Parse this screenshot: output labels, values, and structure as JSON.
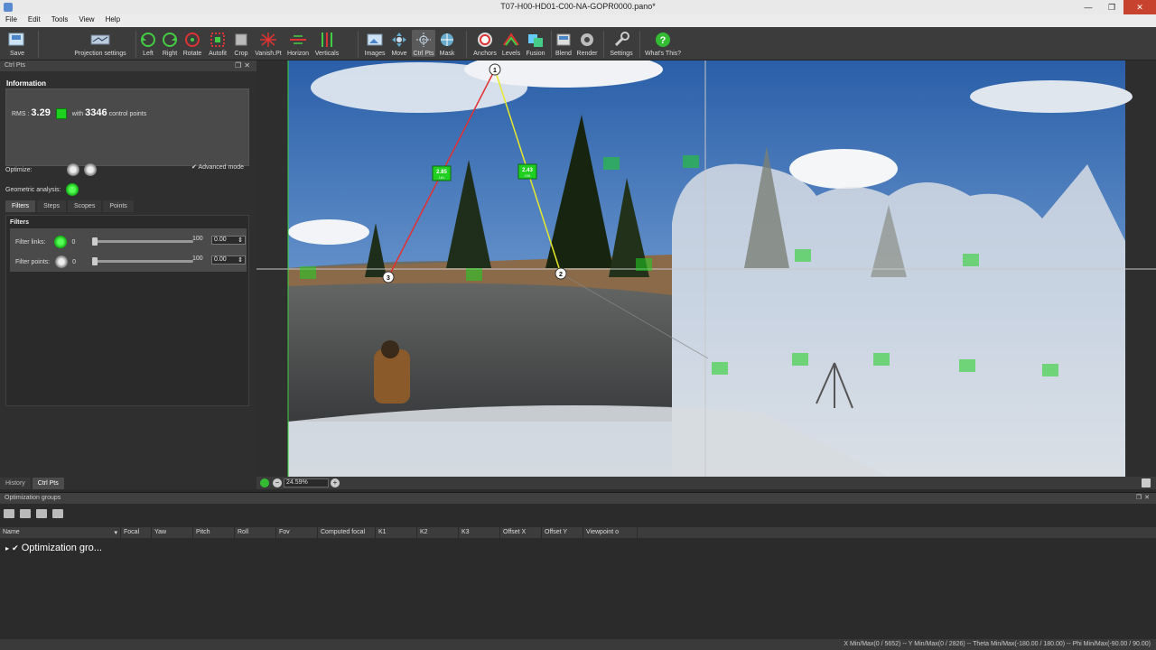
{
  "window": {
    "title": "T07-H00-HD01-C00-NA-GOPR0000.pano*"
  },
  "menu": [
    "File",
    "Edit",
    "Tools",
    "View",
    "Help"
  ],
  "toolbar": {
    "items": [
      {
        "label": "Save",
        "icon": "save-icon"
      },
      {
        "label": "Projection settings",
        "icon": "projection-icon"
      },
      {
        "label": "Left",
        "icon": "rotate-left-icon"
      },
      {
        "label": "Right",
        "icon": "rotate-right-icon"
      },
      {
        "label": "Rotate",
        "icon": "rotate-icon"
      },
      {
        "label": "Autofit",
        "icon": "autofit-icon"
      },
      {
        "label": "Crop",
        "icon": "crop-icon"
      },
      {
        "label": "Vanish.Pt",
        "icon": "vanishing-point-icon"
      },
      {
        "label": "Horizon",
        "icon": "horizon-icon"
      },
      {
        "label": "Verticals",
        "icon": "verticals-icon"
      },
      {
        "label": "Images",
        "icon": "images-icon"
      },
      {
        "label": "Move",
        "icon": "move-icon"
      },
      {
        "label": "Ctrl Pts",
        "icon": "control-points-icon"
      },
      {
        "label": "Mask",
        "icon": "mask-icon"
      },
      {
        "label": "Anchors",
        "icon": "anchors-icon"
      },
      {
        "label": "Levels",
        "icon": "levels-icon"
      },
      {
        "label": "Fusion",
        "icon": "fusion-icon"
      },
      {
        "label": "Blend",
        "icon": "blend-icon"
      },
      {
        "label": "Render",
        "icon": "render-icon"
      },
      {
        "label": "Settings",
        "icon": "settings-icon"
      },
      {
        "label": "What's This?",
        "icon": "help-icon"
      }
    ]
  },
  "ctrlpts_panel": {
    "title": "Ctrl Pts",
    "info_heading": "Information",
    "rms_label": "RMS :",
    "rms_value": "3.29",
    "with_label": "with",
    "cp_count": "3346",
    "cp_label": "control points",
    "optimize_label": "Optimize:",
    "advanced_label": "Advanced mode",
    "geo_label": "Geometric analysis:",
    "tabs": [
      "Filters",
      "Steps",
      "Scopes",
      "Points"
    ],
    "filters_heading": "Filters",
    "filter_links_label": "Filter links:",
    "filter_points_label": "Filter points:",
    "min": "0",
    "max": "100",
    "links_value": "0.00",
    "points_value": "0.00"
  },
  "left_tabs": [
    "History",
    "Ctrl Pts"
  ],
  "viewport": {
    "zoom": "24.59%",
    "points": [
      {
        "id": "1"
      },
      {
        "id": "2"
      },
      {
        "id": "3"
      }
    ],
    "labels_big": [
      {
        "text": "2.85",
        "sub": "181"
      },
      {
        "text": "2.43",
        "sub": "236"
      }
    ]
  },
  "optimization": {
    "title": "Optimization groups",
    "columns": [
      "Name",
      "Focal",
      "Yaw",
      "Pitch",
      "Roll",
      "Fov",
      "Computed focal",
      "K1",
      "K2",
      "K3",
      "Offset X",
      "Offset Y",
      "Viewpoint o"
    ],
    "group_name": "Optimization gro..."
  },
  "status": {
    "text": "X Min/Max(0 / 5652)  --  Y Min/Max(0 / 2826)  --  Theta Min/Max(-180.00 / 180.00)  --  Phi Min/Max(-90.00 / 90.00)"
  }
}
